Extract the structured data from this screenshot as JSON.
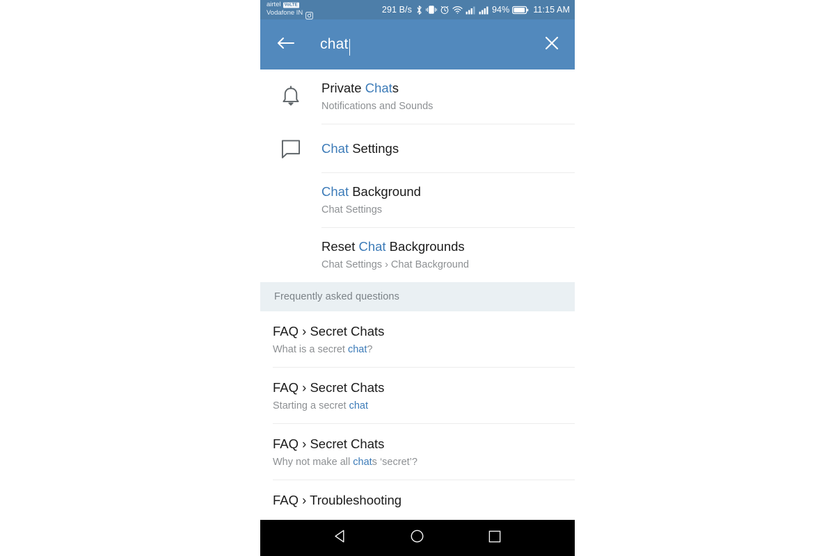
{
  "status_bar": {
    "carrier_primary": "airtel",
    "carrier_badge": "VoLTE",
    "carrier_secondary": "Vodafone IN",
    "network_speed": "291 B/s",
    "battery_percent": "94%",
    "clock": "11:15 AM",
    "icons": [
      "screenshot-icon",
      "bluetooth-icon",
      "vibrate-icon",
      "alarm-icon",
      "wifi-icon",
      "signal-sim1-icon",
      "signal-sim2-icon",
      "battery-icon"
    ],
    "background_color": "#4d7ea9"
  },
  "app_bar": {
    "search_value": "chat",
    "search_placeholder": "Search",
    "back_label": "Back",
    "clear_label": "Clear",
    "background_color": "#5289bd"
  },
  "theme": {
    "highlight_color": "#3c7bb8",
    "section_band_color": "#eaf0f3",
    "divider_color": "#ececec",
    "primary_text_color": "#1b1b1b",
    "secondary_text_color": "#8d9093"
  },
  "settings_results": [
    {
      "icon": "bell-icon",
      "title_prefix": "Private ",
      "title_highlight": "Chat",
      "title_suffix": "s",
      "subtitle": "Notifications and Sounds"
    },
    {
      "icon": "chat-bubble-icon",
      "title_prefix": "",
      "title_highlight": "Chat",
      "title_suffix": " Settings",
      "subtitle": ""
    },
    {
      "icon": "",
      "title_prefix": "",
      "title_highlight": "Chat",
      "title_suffix": " Background",
      "subtitle": "Chat Settings"
    },
    {
      "icon": "",
      "title_prefix": "Reset ",
      "title_highlight": "Chat",
      "title_suffix": " Backgrounds",
      "subtitle": "Chat Settings › Chat Background"
    }
  ],
  "faq_section": {
    "header": "Frequently asked questions",
    "items": [
      {
        "title": "FAQ › Secret Chats",
        "sub_prefix": "What is a secret ",
        "sub_highlight": "chat",
        "sub_suffix": "?"
      },
      {
        "title": "FAQ › Secret Chats",
        "sub_prefix": "Starting a secret ",
        "sub_highlight": "chat",
        "sub_suffix": ""
      },
      {
        "title": "FAQ › Secret Chats",
        "sub_prefix": "Why not make all ",
        "sub_highlight": "chat",
        "sub_suffix": "s ‘secret’?"
      },
      {
        "title": "FAQ › Troubleshooting",
        "sub_prefix": "",
        "sub_highlight": "",
        "sub_suffix": ""
      }
    ]
  },
  "nav_bar": {
    "back": "back-triangle-icon",
    "home": "home-circle-icon",
    "recents": "recents-square-icon"
  }
}
